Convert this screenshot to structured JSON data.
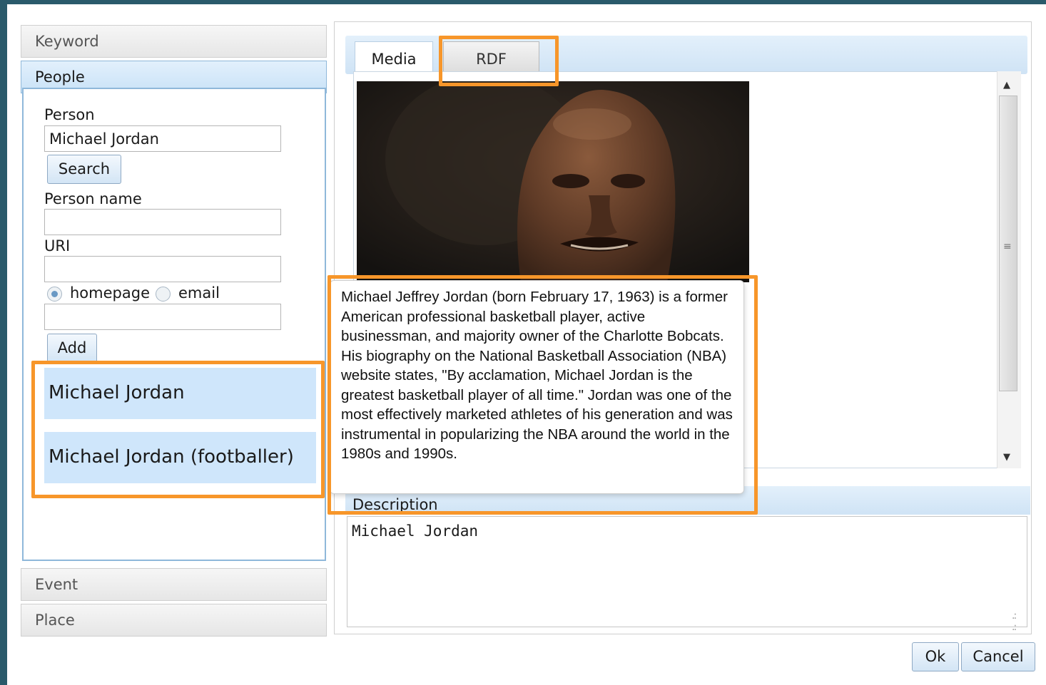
{
  "accordion": {
    "keyword_label": "Keyword",
    "people_label": "People",
    "event_label": "Event",
    "place_label": "Place"
  },
  "people_form": {
    "person_label": "Person",
    "person_value": "Michael Jordan",
    "search_label": "Search",
    "person_name_label": "Person name",
    "person_name_value": "",
    "uri_label": "URI",
    "uri_value": "",
    "radio_homepage": "homepage",
    "radio_email": "email",
    "radio_selected": "homepage",
    "contact_value": "",
    "add_label": "Add"
  },
  "results": [
    {
      "label": "Michael Jordan"
    },
    {
      "label": "Michael Jordan (footballer)"
    }
  ],
  "tabs": {
    "media": "Media",
    "rdf": "RDF",
    "active": "Media"
  },
  "tooltip": {
    "text": "Michael Jeffrey Jordan (born February 17, 1963) is a former American professional basketball player, active businessman, and majority owner of the Charlotte Bobcats. His biography on the National Basketball Association (NBA) website states, \"By acclamation, Michael Jordan is the greatest basketball player of all time.\" Jordan was one of the most effectively marketed athletes of his generation and was instrumental in popularizing the NBA around the world in the 1980s and 1990s."
  },
  "description": {
    "label": "Description",
    "value": "Michael Jordan"
  },
  "buttons": {
    "ok": "Ok",
    "cancel": "Cancel"
  },
  "colors": {
    "highlight": "#f7962a",
    "selection": "#cfe6fb",
    "accent": "#8fb8da"
  }
}
